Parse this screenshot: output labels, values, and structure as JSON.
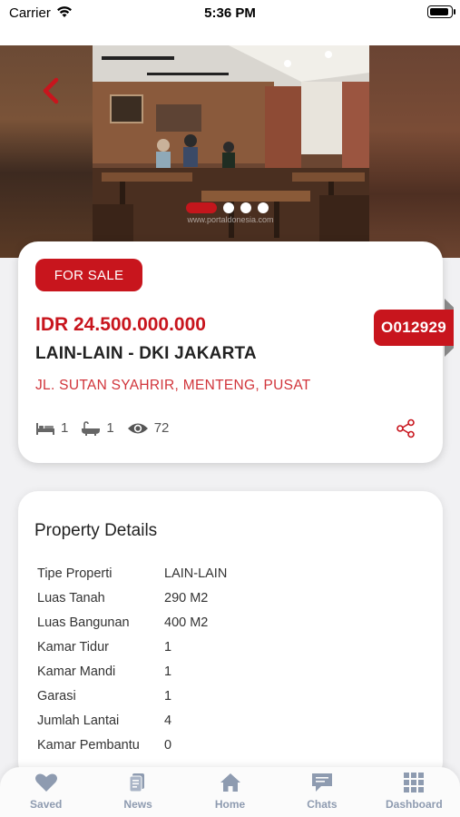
{
  "status_bar": {
    "carrier": "Carrier",
    "time": "5:36 PM"
  },
  "hero": {
    "slide_count": 4,
    "active_slide": 1,
    "watermark": "www.portaldonesia.com"
  },
  "listing": {
    "badge": "FOR SALE",
    "price": "IDR 24.500.000.000",
    "title": "LAIN-LAIN - DKI JAKARTA",
    "address": "JL. SUTAN SYAHRIR, MENTENG, PUSAT",
    "code": "O012929",
    "bedrooms": "1",
    "bathrooms": "1",
    "views": "72"
  },
  "details": {
    "title": "Property Details",
    "rows": [
      {
        "label": "Tipe Properti",
        "value": "LAIN-LAIN"
      },
      {
        "label": "Luas Tanah",
        "value": "290 M2"
      },
      {
        "label": "Luas Bangunan",
        "value": "400 M2"
      },
      {
        "label": "Kamar Tidur",
        "value": "1"
      },
      {
        "label": "Kamar Mandi",
        "value": "1"
      },
      {
        "label": "Garasi",
        "value": "1"
      },
      {
        "label": "Jumlah Lantai",
        "value": "4"
      },
      {
        "label": "Kamar Pembantu",
        "value": "0"
      }
    ]
  },
  "nav": {
    "items": [
      {
        "label": "Saved",
        "icon": "heart-icon"
      },
      {
        "label": "News",
        "icon": "news-icon"
      },
      {
        "label": "Home",
        "icon": "home-icon"
      },
      {
        "label": "Chats",
        "icon": "chat-icon"
      },
      {
        "label": "Dashboard",
        "icon": "grid-icon"
      }
    ]
  },
  "colors": {
    "brand_red": "#c8151d",
    "nav_gray": "#8e9bb0"
  }
}
